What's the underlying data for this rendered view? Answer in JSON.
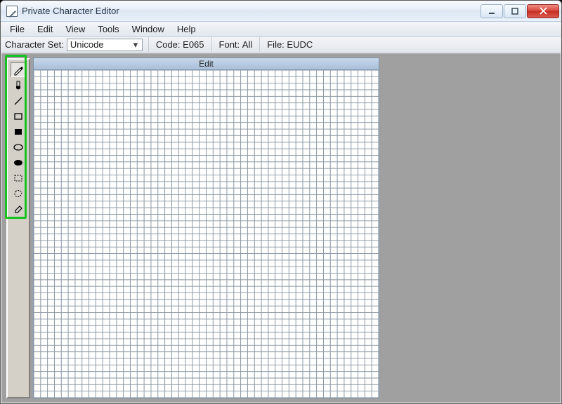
{
  "window": {
    "title": "Private Character Editor"
  },
  "menubar": {
    "items": [
      "File",
      "Edit",
      "View",
      "Tools",
      "Window",
      "Help"
    ]
  },
  "infobar": {
    "charset_label": "Character Set:",
    "charset_value": "Unicode",
    "code_label": "Code:",
    "code_value": "E065",
    "font_label": "Font:",
    "font_value": "All",
    "file_label": "File:",
    "file_value": "EUDC"
  },
  "toolbox": {
    "tools": [
      {
        "name": "pencil",
        "selected": true
      },
      {
        "name": "brush",
        "selected": false
      },
      {
        "name": "line",
        "selected": false
      },
      {
        "name": "rect-outline",
        "selected": false
      },
      {
        "name": "rect-filled",
        "selected": false
      },
      {
        "name": "ellipse-outline",
        "selected": false
      },
      {
        "name": "ellipse-filled",
        "selected": false
      },
      {
        "name": "select-rect",
        "selected": false
      },
      {
        "name": "select-free",
        "selected": false
      },
      {
        "name": "eraser",
        "selected": false
      }
    ]
  },
  "editpanel": {
    "caption": "Edit",
    "grid_size": 50
  }
}
